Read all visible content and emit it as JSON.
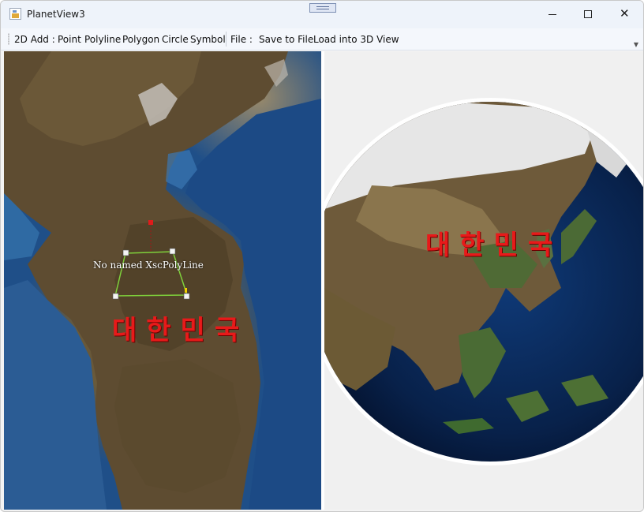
{
  "window": {
    "title": "PlanetView3"
  },
  "toolbar": {
    "add_label": "2D Add :",
    "point": "Point",
    "polyline": "Polyline",
    "polygon": "Polygon",
    "circle": "Circle",
    "symbol": "Symbol",
    "file_label": "File :",
    "save_to_file": "Save to File",
    "load_into_3d": "Load into 3D View"
  },
  "map2d": {
    "polyline_name": "No named XscPolyLine",
    "country_label": "대한민국"
  },
  "view3d": {
    "country_label": "대한민국"
  },
  "colors": {
    "label_red": "#e81a1a",
    "polyline_green": "#7fd13b",
    "ocean": "#1f4f88",
    "land": "#5b4a30"
  }
}
